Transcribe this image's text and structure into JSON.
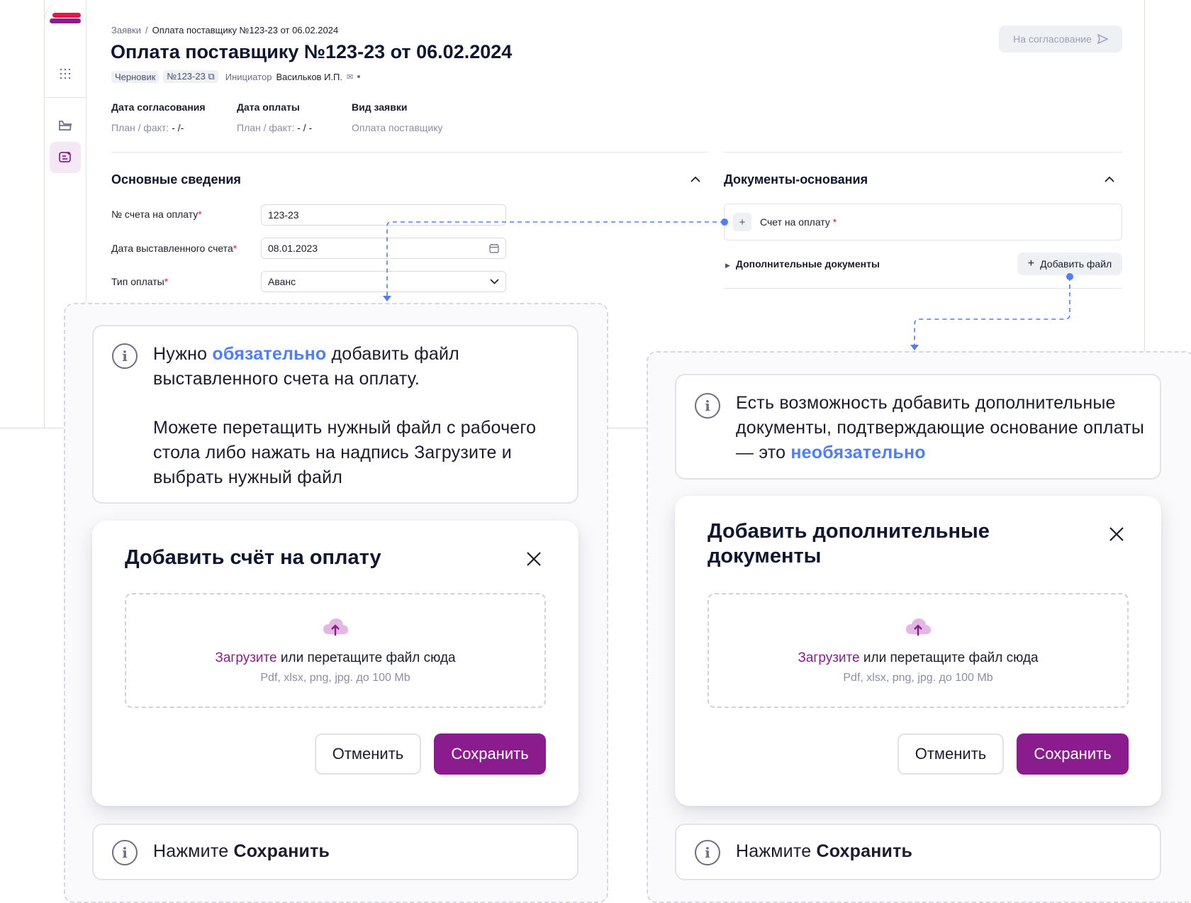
{
  "colors": {
    "brand_primary": "#8b1c8e",
    "brand_red": "#e2184a",
    "accent_blue": "#4f7dff",
    "required_mark": "#e2184a"
  },
  "breadcrumb": {
    "root": "Заявки",
    "separator": "/",
    "current": "Оплата поставщику №123-23 от 06.02.2024"
  },
  "page": {
    "title": "Оплата поставщику №123-23 от 06.02.2024",
    "status_tag": "Черновик",
    "number_tag": "№123-23",
    "initiator_label": "Инициатор",
    "initiator_name": "Васильков И.П.",
    "submit_button": "На согласование"
  },
  "meta": [
    {
      "label": "Дата согласования",
      "prefix": "План / факт:",
      "value": "- /-"
    },
    {
      "label": "Дата оплаты",
      "prefix": "План / факт:",
      "value": "- / -"
    },
    {
      "label": "Вид заявки",
      "prefix": "",
      "value": "Оплата поставщику"
    }
  ],
  "main_info": {
    "title": "Основные сведения",
    "fields": [
      {
        "label": "№ счета на оплату",
        "required": true,
        "value": "123-23"
      },
      {
        "label": "Дата выставленного счета",
        "required": true,
        "value": "08.01.2023"
      },
      {
        "label": "Тип оплаты",
        "required": true,
        "value": "Аванс"
      }
    ]
  },
  "documents": {
    "title": "Документы-основания",
    "invoice_row": "Счет на оплату",
    "extra_docs": "Дополнительные документы",
    "add_file_button": "Добавить файл"
  },
  "left_callout": {
    "hint_prefix": "Нужно ",
    "hint_accent": "обязательно",
    "hint_suffix": " добавить файл выставленного  счета на оплату.",
    "hint_second": "Можете перетащить нужный файл с рабочего стола либо нажать на надпись Загрузите и выбрать нужный файл",
    "modal_title": "Добавить счёт на оплату",
    "upload_link": "Загрузите",
    "upload_text": " или перетащите файл сюда",
    "upload_formats": "Pdf, xlsx, png, jpg. до 100 Mb",
    "cancel_button": "Отменить",
    "save_button": "Сохранить",
    "footer_prefix": "Нажмите ",
    "footer_bold": "Сохранить"
  },
  "right_callout": {
    "hint_text": "Есть возможность добавить дополнительные документы, подтверждающие основание оплаты — это ",
    "hint_accent": "необязательно",
    "modal_title": "Добавить дополнительные документы",
    "upload_link": "Загрузите",
    "upload_text": " или перетащите файл сюда",
    "upload_formats": "Pdf, xlsx, png, jpg. до 100 Mb",
    "cancel_button": "Отменить",
    "save_button": "Сохранить",
    "footer_prefix": "Нажмите ",
    "footer_bold": "Сохранить"
  },
  "icons": {
    "sidebar": [
      "logo",
      "apps-grid-icon",
      "folder-icon",
      "request-icon"
    ],
    "info": "info-icon",
    "close": "close-icon",
    "upload": "cloud-upload-icon"
  }
}
